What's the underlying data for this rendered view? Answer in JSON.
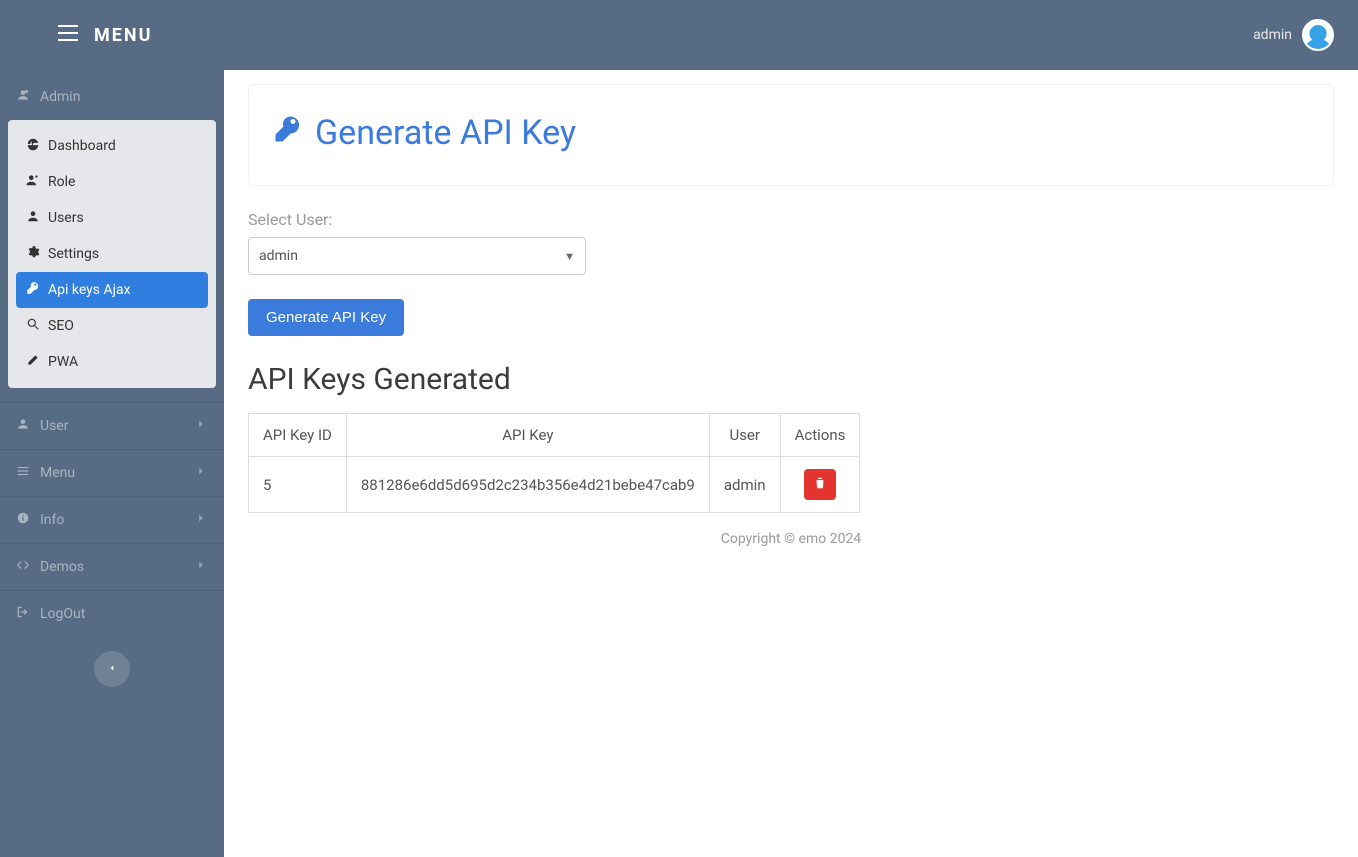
{
  "topbar": {
    "menu_label": "MENU",
    "username": "admin"
  },
  "sidebar": {
    "section_admin": {
      "label": "Admin"
    },
    "submenu": [
      {
        "label": "Dashboard",
        "icon": "dashboard",
        "active": false
      },
      {
        "label": "Role",
        "icon": "role",
        "active": false
      },
      {
        "label": "Users",
        "icon": "user",
        "active": false
      },
      {
        "label": "Settings",
        "icon": "gear",
        "active": false
      },
      {
        "label": "Api keys Ajax",
        "icon": "key",
        "active": true
      },
      {
        "label": "SEO",
        "icon": "search",
        "active": false
      },
      {
        "label": "PWA",
        "icon": "edit",
        "active": false
      }
    ],
    "section_user": {
      "label": "User"
    },
    "section_menu": {
      "label": "Menu"
    },
    "section_info": {
      "label": "Info"
    },
    "section_demos": {
      "label": "Demos"
    },
    "section_logout": {
      "label": "LogOut"
    }
  },
  "page": {
    "title": "Generate API Key",
    "form": {
      "select_label": "Select User:",
      "select_value": "admin",
      "submit_label": "Generate API Key"
    },
    "table_title": "API Keys Generated",
    "table": {
      "headers": [
        "API Key ID",
        "API Key",
        "User",
        "Actions"
      ],
      "rows": [
        {
          "id": "5",
          "key": "881286e6dd5d695d2c234b356e4d21bebe47cab9",
          "user": "admin"
        }
      ]
    }
  },
  "footer": {
    "text": "Copyright © emo 2024"
  }
}
